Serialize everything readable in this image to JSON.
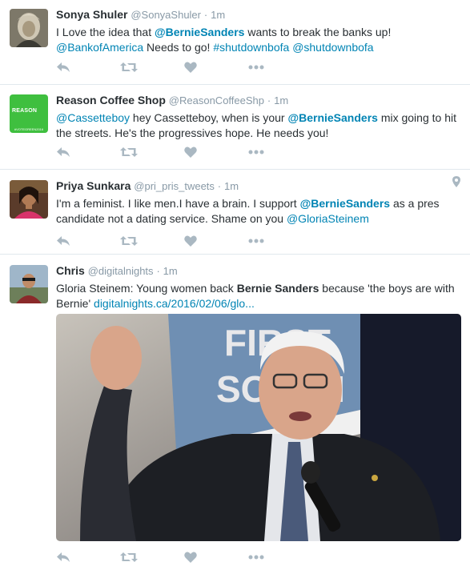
{
  "tweets": [
    {
      "name": "Sonya Shuler",
      "handle": "@SonyaShuler",
      "dot": "·",
      "time": "1m",
      "text": {
        "t1": "I Love the idea that ",
        "mention1": "@BernieSanders",
        "t2": " wants to break the banks up!",
        "mention2": "@BankofAmerica",
        "t3": " Needs to go! ",
        "hashtag": "#shutdownbofa",
        "t4": " ",
        "mention3": "@shutdownbofa"
      }
    },
    {
      "name": "Reason Coffee Shop",
      "handle": "@ReasonCoffeeShp",
      "dot": "·",
      "time": "1m",
      "avatar": {
        "line1": "REASON",
        "line2": "#VOTEGREEN2016"
      },
      "text": {
        "mention1": "@Cassetteboy",
        "t1": " hey Cassetteboy, when is your ",
        "mention2": "@BernieSanders",
        "t2": " mix going to hit the streets. He's the progressives hope. He needs you!"
      }
    },
    {
      "name": "Priya Sunkara",
      "handle": "@pri_pris_tweets",
      "dot": "·",
      "time": "1m",
      "text": {
        "t1": "I'm a feminist. I like men.I have a brain. I support ",
        "mention1": "@BernieSanders",
        "t2": " as a pres candidate not a dating service. Shame on you ",
        "mention2": "@GloriaSteinem"
      }
    },
    {
      "name": "Chris",
      "handle": "@digitalnights",
      "dot": "·",
      "time": "1m",
      "text": {
        "t1": "Gloria Steinem: Young women back ",
        "bold1": "Bernie Sanders",
        "t2": " because 'the boys are with Bernie' ",
        "url": "digitalnights.ca/2016/02/06/glo..."
      },
      "media": {
        "sign_line1": "FIRST",
        "sign_line2": "SOUTH"
      }
    }
  ],
  "colors": {
    "link": "#0084b4",
    "icon": "#aab8c2",
    "meta": "#8899a6",
    "divider": "#e1e8ed"
  },
  "icons": [
    "reply-icon",
    "retweet-icon",
    "like-icon",
    "more-icon",
    "location-pin-icon"
  ]
}
